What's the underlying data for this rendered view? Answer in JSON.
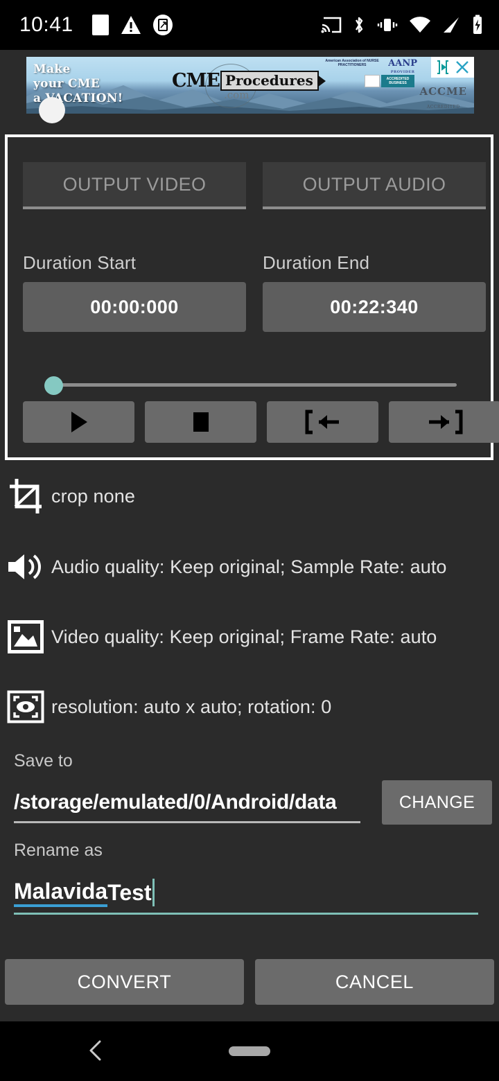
{
  "statusbar": {
    "time": "10:41",
    "left_icons": [
      "sim-card-icon",
      "warning-triangle-icon",
      "screenshot-icon"
    ],
    "right_icons": [
      "cast-icon",
      "bluetooth-icon",
      "vibrate-icon",
      "wifi-icon",
      "cellular-signal-icon",
      "battery-charging-icon"
    ]
  },
  "ad": {
    "headline_line1": "Make",
    "headline_line2": "your CME",
    "headline_line3": "a VACATION!",
    "logo_main": "CME",
    "logo_sub": "Procedures",
    "logo_tld": ".com",
    "badge_aanp": "AANP",
    "badge_aanp_sub": "PROVIDER",
    "badge_assoc": "American Association of NURSE PRACTITIONERS",
    "badge_bbb": "ACCREDITED BUSINESS",
    "badge_accme": "ACCME",
    "badge_accme_sub": "ACCREDITED",
    "adchoices_icon": "adchoices-icon",
    "close_icon": "close-icon"
  },
  "player": {
    "output_video_label": "OUTPUT VIDEO",
    "output_audio_label": "OUTPUT AUDIO",
    "duration_start_label": "Duration Start",
    "duration_end_label": "Duration End",
    "duration_start_value": "00:00:000",
    "duration_end_value": "00:22:340",
    "seek_position_percent": 0,
    "buttons": [
      {
        "name": "play-button",
        "icon": "play-icon"
      },
      {
        "name": "stop-button",
        "icon": "stop-icon"
      },
      {
        "name": "set-start-button",
        "icon": "set-start-bracket-icon"
      },
      {
        "name": "set-end-button",
        "icon": "set-end-bracket-icon"
      }
    ],
    "accent_color": "#85c9c2"
  },
  "options": [
    {
      "icon": "crop-icon",
      "text": "crop none"
    },
    {
      "icon": "speaker-icon",
      "text": "Audio quality: Keep original; Sample Rate: auto"
    },
    {
      "icon": "image-icon",
      "text": "Video quality: Keep original; Frame Rate: auto"
    },
    {
      "icon": "resolution-eye-icon",
      "text": "resolution: auto x auto; rotation: 0"
    }
  ],
  "save": {
    "label": "Save to",
    "path": "/storage/emulated/0/Android/data",
    "change_label": "CHANGE"
  },
  "rename": {
    "label": "Rename as",
    "value_misspelled": "Malavida",
    "value_rest": " Test",
    "underline_color": "#7fc0b7",
    "spellcheck_color": "#3a9fd4"
  },
  "actions": {
    "convert_label": "CONVERT",
    "cancel_label": "CANCEL"
  },
  "navbar": {
    "back_icon": "back-chevron-icon",
    "home_icon": "home-pill-icon"
  }
}
